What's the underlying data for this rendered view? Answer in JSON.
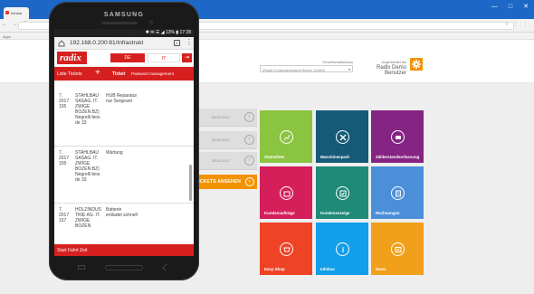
{
  "browser": {
    "tab_title": "Infrastr",
    "bookmarks": "Apps",
    "window_controls": [
      "—",
      "□",
      "✕"
    ],
    "nav_arrows": "← → C",
    "nav_right_icons": "☆ ⋮ ⋮"
  },
  "header": {
    "select_caption": "Gesellschaftsfokus",
    "select_value": "(Radix Computersystem Bozen GmbH)",
    "user_caption": "Angemeldet als",
    "user_name": "Radix Demo Benutzer"
  },
  "tickets_bg": [
    {
      "date": "03.03.2017"
    },
    {
      "date": "03.03.2017"
    },
    {
      "date": "03.03.2017"
    }
  ],
  "view_button": "TICKETS ANSEHEN",
  "tiles": [
    {
      "label": "Statistiken",
      "color": "#8bc440",
      "icon": "chart-icon"
    },
    {
      "label": "Maschinenpark",
      "color": "#165a79",
      "icon": "tools-icon"
    },
    {
      "label": "Zählerstandserfassung",
      "color": "#862483",
      "icon": "counter-icon"
    },
    {
      "label": "Kundenaufträge",
      "color": "#d41f5a",
      "icon": "folder-icon"
    },
    {
      "label": "Kundenanzeige",
      "color": "#1e8a77",
      "icon": "screen-icon"
    },
    {
      "label": "Rechnungen",
      "color": "#4b8fd8",
      "icon": "invoice-icon"
    },
    {
      "label": "Easy-Shop",
      "color": "#ee4325",
      "icon": "cart-icon"
    },
    {
      "label": "Infobox",
      "color": "#129ee8",
      "icon": "info-icon"
    },
    {
      "label": "News",
      "color": "#f0a01a",
      "icon": "news-icon"
    }
  ],
  "phone": {
    "brand": "SAMSUNG",
    "status": "✱ ✉ ☰ ◢ 13% ▮ 17:28",
    "url": "192.168.0.200:81/Infrastrukt",
    "tabs_count": "1",
    "logo": "radix",
    "lang_de": "DE",
    "lang_it": "IT",
    "logout": "⇥",
    "nav": {
      "tickets_label": "Liste Tickets",
      "plus": "+",
      "ticket": "Ticket",
      "management": "Passwort management"
    },
    "rows": [
      {
        "c1": "7. 2017 155",
        "c2": "STAHLBAU SASAG. IT. ZWIGE BOZEN BZ) Negrelli bios de 33",
        "c3": "HUB Reparatur nur Sergeant"
      },
      {
        "c1": "7. 2017 155",
        "c2": "STAHLBAU SASAG. IT. ZWIGE BOZEN BZ) Negrelli bios de 33",
        "c3": "Wartung"
      },
      {
        "c1": "7. 2017 157",
        "c2": "HOLZINDUS TRIE AG. IT. ZWIGE BOZEN",
        "c3": "Batterie entladet schnell"
      }
    ],
    "footer": "Start Fahrt Zeit"
  }
}
